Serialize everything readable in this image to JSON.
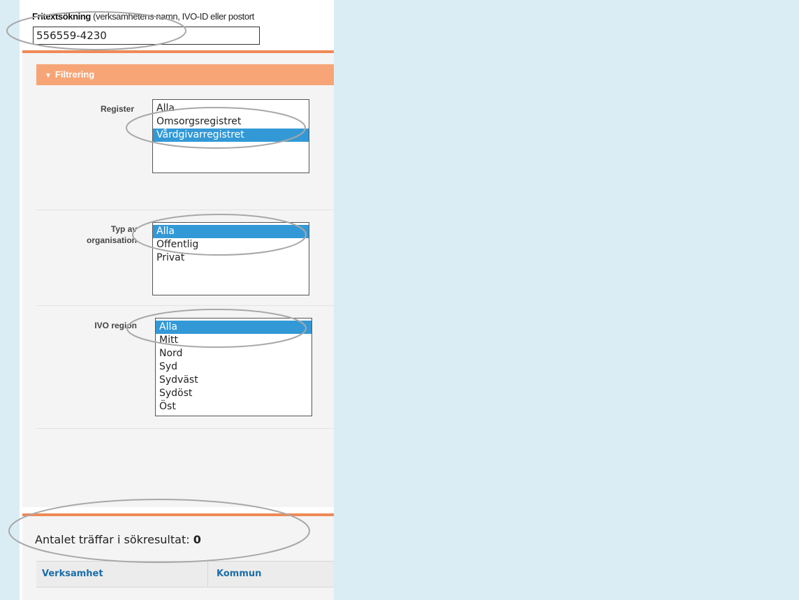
{
  "search": {
    "label_bold": "Fritextsökning",
    "label_rest": " (verksamhetens namn, IVO-ID eller postort",
    "value": "556559-4230"
  },
  "filter": {
    "title": "Filtrering",
    "register": {
      "label": "Register",
      "options": [
        "Alla",
        "Omsorgsregistret",
        "Vårdgivarregistret"
      ],
      "selected": "Vårdgivarregistret"
    },
    "org_type": {
      "label_line1": "Typ av",
      "label_line2": "organisation",
      "options": [
        "Alla",
        "Offentlig",
        "Privat"
      ],
      "selected": "Alla"
    },
    "region": {
      "label": "IVO region",
      "options": [
        "Alla",
        "Mitt",
        "Nord",
        "Syd",
        "Sydväst",
        "Sydöst",
        "Öst"
      ],
      "selected": "Alla"
    }
  },
  "results": {
    "count_label": "Antalet träffar i sökresultat:",
    "count_value": "0",
    "columns": [
      "Verksamhet",
      "Kommun"
    ]
  },
  "colors": {
    "accent_orange": "#ef8a57",
    "filter_header": "#f7a577",
    "selection_blue": "#3399d6",
    "link_blue": "#1b6ea8"
  }
}
